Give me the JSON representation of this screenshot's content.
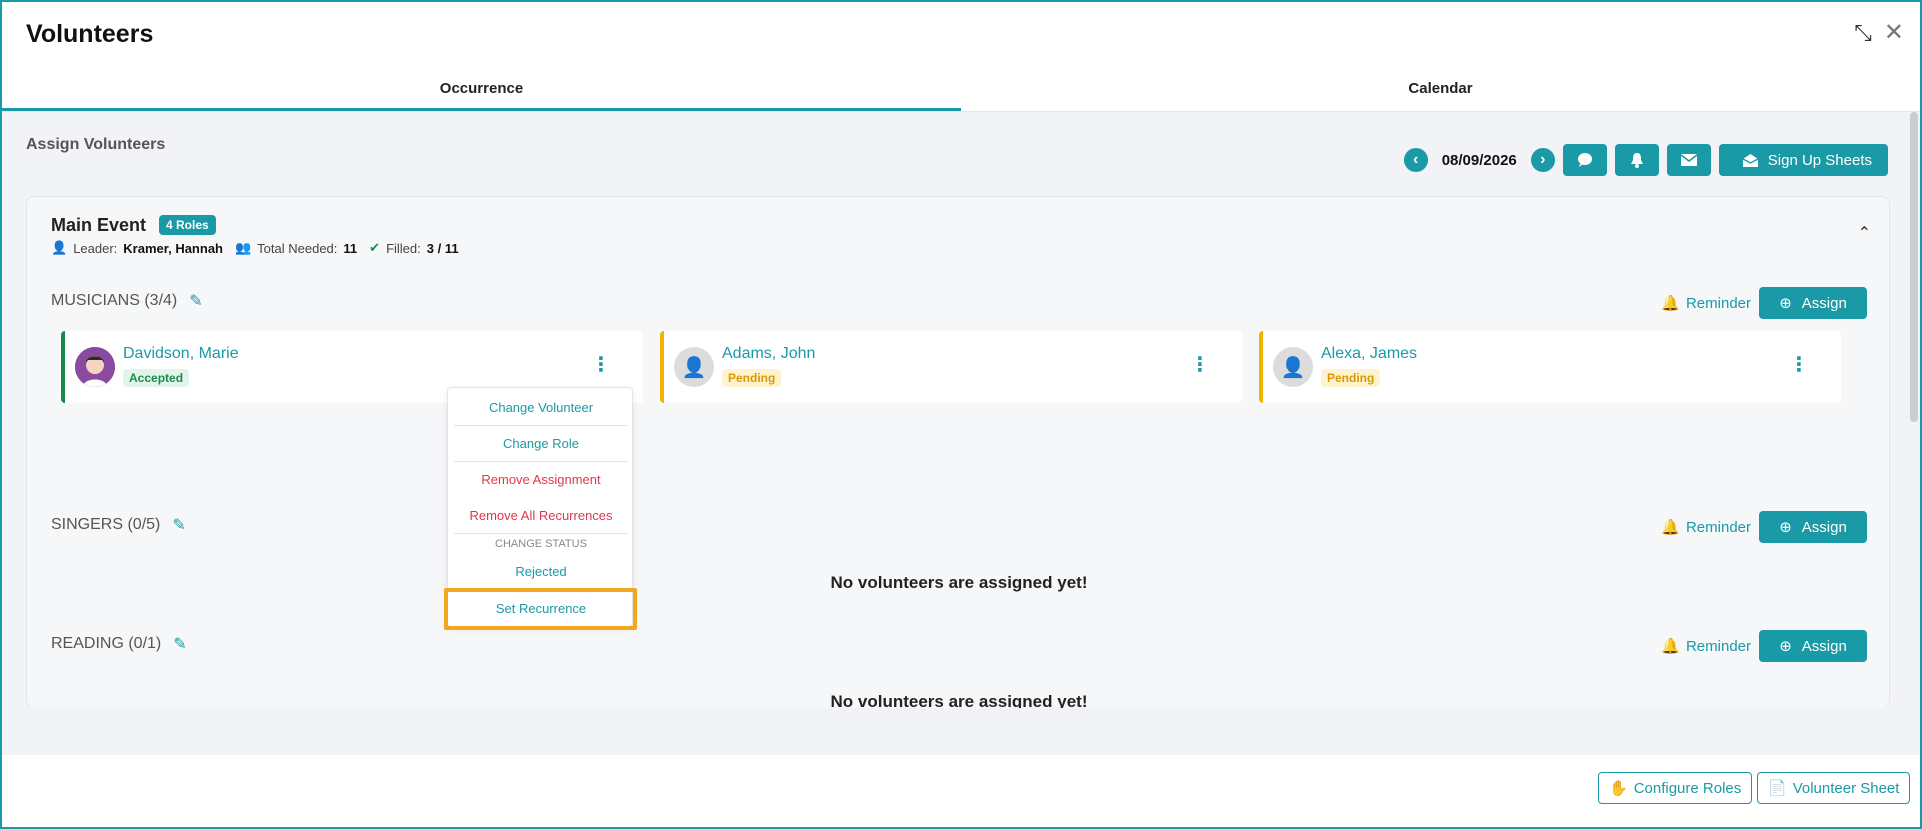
{
  "window": {
    "title": "Volunteers",
    "minimize_icon": "compress-icon",
    "close_icon": "close-icon"
  },
  "tabs": [
    {
      "label": "Occurrence",
      "active": true
    },
    {
      "label": "Calendar",
      "active": false
    }
  ],
  "assign_section": {
    "title": "Assign Volunteers",
    "date": "08/09/2026",
    "signup_label": "Sign Up Sheets"
  },
  "event": {
    "name": "Main Event",
    "roles_badge": "4 Roles",
    "leader_label": "Leader:",
    "leader_name": "Kramer, Hannah",
    "total_needed_label": "Total Needed:",
    "total_needed_value": "11",
    "filled_label": "Filled:",
    "filled_value": "3 / 11"
  },
  "roles": [
    {
      "title": "MUSICIANS (3/4)",
      "reminder_label": "Reminder",
      "assign_label": "Assign"
    },
    {
      "title": "SINGERS (0/5)",
      "reminder_label": "Reminder",
      "assign_label": "Assign",
      "empty_text": "No volunteers are assigned yet!"
    },
    {
      "title": "READING (0/1)",
      "reminder_label": "Reminder",
      "assign_label": "Assign",
      "empty_text": "No volunteers are assigned yet!"
    }
  ],
  "volunteers": [
    {
      "name": "Davidson, Marie",
      "status": "Accepted"
    },
    {
      "name": "Adams, John",
      "status": "Pending"
    },
    {
      "name": "Alexa, James",
      "status": "Pending"
    }
  ],
  "dropdown": {
    "change_volunteer": "Change Volunteer",
    "change_role": "Change Role",
    "remove_assignment": "Remove Assignment",
    "remove_all": "Remove All Recurrences",
    "change_status_header": "CHANGE STATUS",
    "rejected": "Rejected",
    "set_recurrence": "Set Recurrence"
  },
  "footer": {
    "configure_roles": "Configure Roles",
    "volunteer_sheet": "Volunteer Sheet"
  },
  "colors": {
    "accent": "#1a9aa6",
    "accepted": "#1a8a4a",
    "pending": "#f0b400",
    "danger": "#e0384a",
    "highlight": "#f0a820"
  }
}
